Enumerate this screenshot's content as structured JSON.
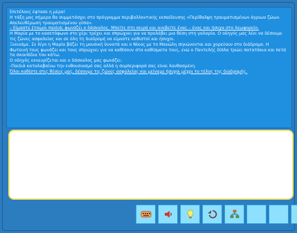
{
  "reading": {
    "paragraphs": [
      "Επιτέλους έφτασε η μέρα!",
      "Η τάξη μας σήμερα θα συμμετάσχει στο πρόγραμμα περιβαλλοντικής εκπαίδευσης «Περίθαλψη τραυματισμένων άγριων ζώων. Απελευθέρωση τραυματισμένου γύπα».",
      "– Είμαστε έτοιμοι παιδιά; φωνάζει ο δάσκαλος. Μπείτε στη σειρά και ανεβείτε ένας – ένας και ήσυχα στο λεωφορείο.",
      "Η Μαρία με το κασετόφωνο στο χέρι τρέχει και σπρώχνει για να προλάβει μια θέση στη γαλαρία. Ο οδηγός μας λέει να δέσουμε τις ζώνες ασφαλείας και σε όλη τη διαδρομή να είμαστε καθιστοί και ήσυχοι.",
      "Ξεκινάμε. Σε λίγο η Μαρία βάζει τη μουσική δυνατά και ο Νίκος με το Μανώλη σηκώνονται και χορεύουν στο διάδρομο. Η Φωτεινή τους φωνάζει και τους σπρώχνει για να καθίσουν στα καθίσματα τους, ενώ ο Παντελής δίπλα τρώει πατατάκια και πετά τα σκουπίδια του κάτω.",
      "Ο οδηγός εκνευρίζεται και ο δάσκαλος μας φωνάζει:",
      "-Παιδιά καταλαβαίνω την ενθουσιασμό σας αλλά η συμπεριφορά σας είναι λανθασμένη.",
      "Όλοι καθίστε στις θέσεις μας, δέσουμε τις ζώνες ασφαλείας και μείναμε ήσυχοι μέχρι το τέλος της διαδρομής."
    ]
  },
  "answer_box": {
    "value": ""
  },
  "toolbar": {
    "buttons": [
      {
        "icon": "keyboard-icon"
      },
      {
        "icon": "speaker-icon"
      },
      {
        "icon": "lightbulb-icon"
      },
      {
        "icon": "undo-icon"
      },
      {
        "icon": "hierarchy-icon"
      },
      {
        "icon": ""
      },
      {
        "icon": ""
      },
      {
        "icon": "exit-icon"
      }
    ]
  },
  "colors": {
    "background": "#2c7cc0",
    "panel": "#1f8fe0",
    "toolbar": "#8ee0ff",
    "answer_border": "#f2e46a"
  }
}
